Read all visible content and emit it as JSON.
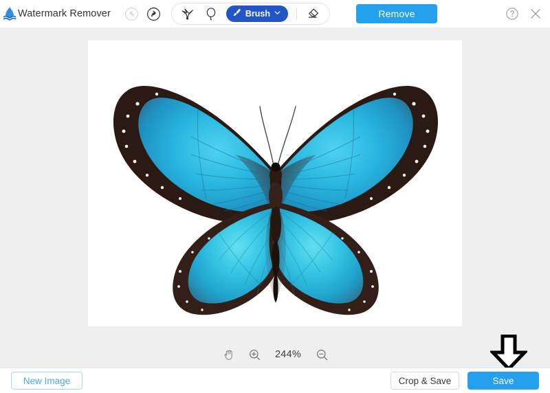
{
  "app": {
    "title": "Watermark Remover",
    "logo_icon": "water-drop-logo"
  },
  "header": {
    "history": [
      {
        "name": "undo-button",
        "icon": "undo-arrow-icon",
        "label": "Undo",
        "disabled": true
      },
      {
        "name": "redo-button",
        "icon": "redo-arrow-icon",
        "label": "Redo",
        "disabled": false
      }
    ],
    "tools": [
      {
        "name": "polygon-lasso-tool",
        "icon": "polygon-lasso-icon",
        "label": "Polygonal Lasso"
      },
      {
        "name": "lasso-tool",
        "icon": "lasso-icon",
        "label": "Lasso"
      }
    ],
    "brush": {
      "label": "Brush",
      "icon": "brush-icon",
      "chevron": "chevron-down-icon",
      "color": "#2256c5"
    },
    "eraser": {
      "name": "eraser-tool",
      "icon": "eraser-icon",
      "label": "Eraser"
    },
    "remove_button": {
      "label": "Remove",
      "color": "#24a0ed"
    },
    "help_icon": "help-circle-icon",
    "close_icon": "close-icon"
  },
  "workspace": {
    "background_color": "#efeff0",
    "canvas": {
      "name": "image-canvas",
      "background_color": "#ffffff",
      "image_subject": "blue-morpho-butterfly"
    },
    "zoom": {
      "pan_icon": "hand-pan-icon",
      "zoom_in_icon": "zoom-in-icon",
      "zoom_out_icon": "zoom-out-icon",
      "level": "244%"
    },
    "annotation": {
      "name": "down-arrow-annotation",
      "icon": "down-arrow-icon",
      "color": "#000000"
    }
  },
  "footer": {
    "new_image_button": {
      "label": "New Image",
      "border_color": "#a6d9f5",
      "text_color": "#4aa8e0"
    },
    "crop_save_button": {
      "label": "Crop & Save",
      "border_color": "#d8d8da",
      "text_color": "#3a3a3a"
    },
    "save_button": {
      "label": "Save",
      "color": "#24a0ed",
      "text_color": "#ffffff"
    }
  }
}
